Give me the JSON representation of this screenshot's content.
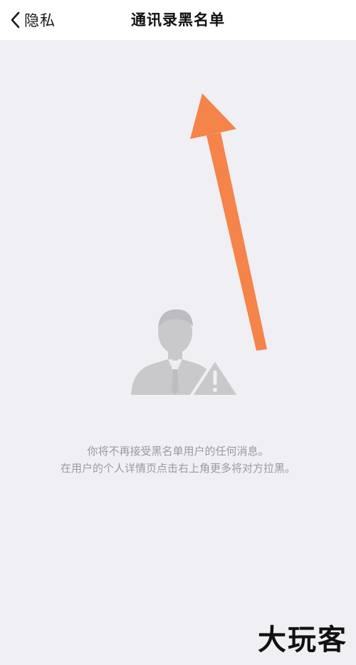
{
  "navbar": {
    "back_label": "隐私",
    "title": "通讯录黑名单"
  },
  "empty_state": {
    "line1": "你将不再接受黑名单用户的任何消息。",
    "line2": "在用户的个人详情页点击右上角更多将对方拉黑。"
  },
  "icons": {
    "back": "chevron-left-icon",
    "illustration": "blocked-user-warning-icon",
    "annotation": "orange-arrow-annotation"
  },
  "colors": {
    "navbar_bg": "#ffffff",
    "page_bg": "#efeff4",
    "hint_text": "#9a9a9f",
    "annotation_arrow": "#f5844a",
    "illustration_gray": "#c9c9cc"
  },
  "watermark": {
    "text": "大玩客"
  }
}
